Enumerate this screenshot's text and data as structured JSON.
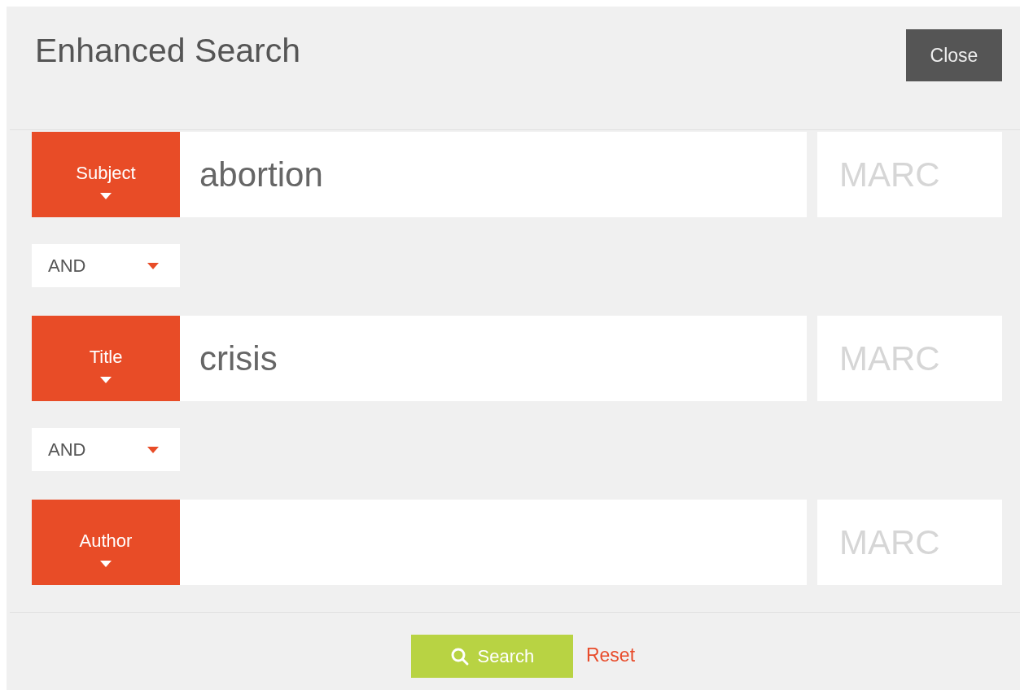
{
  "dialog": {
    "title": "Enhanced Search",
    "close_button": "Close"
  },
  "rows": [
    {
      "kind": "term",
      "field": "Subject",
      "value": "abortion",
      "marc_placeholder": "MARC"
    },
    {
      "kind": "operator",
      "operator": "AND"
    },
    {
      "kind": "term",
      "field": "Title",
      "value": "crisis",
      "marc_placeholder": "MARC"
    },
    {
      "kind": "operator",
      "operator": "AND"
    },
    {
      "kind": "term",
      "field": "Author",
      "value": "",
      "marc_placeholder": "MARC"
    }
  ],
  "footer": {
    "search_button": "Search",
    "reset_link": "Reset"
  }
}
